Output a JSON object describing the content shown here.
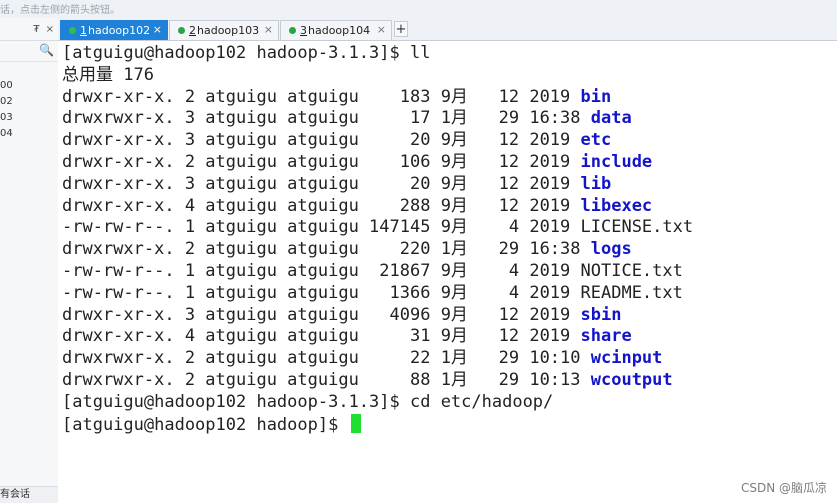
{
  "topbar": {
    "hint": "话，点击左侧的箭头按钮。"
  },
  "left_panel": {
    "pin_glyph": "₮",
    "close_glyph": "×",
    "search_glyph": "🔍",
    "items": [
      "00",
      "02",
      "03",
      "04"
    ],
    "footer_label": "有会话"
  },
  "tabs": [
    {
      "num": "1",
      "label": "hadoop102",
      "active": true
    },
    {
      "num": "2",
      "label": "hadoop103",
      "active": false
    },
    {
      "num": "3",
      "label": "hadoop104",
      "active": false
    }
  ],
  "tab_close_glyph": "×",
  "add_tab_glyph": "+",
  "terminal": {
    "lines": [
      {
        "text": "[atguigu@hadoop102 hadoop-3.1.3]$ ll",
        "name": ""
      },
      {
        "text": "总用量 176",
        "name": ""
      },
      {
        "text": "drwxr-xr-x. 2 atguigu atguigu    183 9月   12 2019 ",
        "name": "bin",
        "dir": true
      },
      {
        "text": "drwxrwxr-x. 3 atguigu atguigu     17 1月   29 16:38 ",
        "name": "data",
        "dir": true
      },
      {
        "text": "drwxr-xr-x. 3 atguigu atguigu     20 9月   12 2019 ",
        "name": "etc",
        "dir": true
      },
      {
        "text": "drwxr-xr-x. 2 atguigu atguigu    106 9月   12 2019 ",
        "name": "include",
        "dir": true
      },
      {
        "text": "drwxr-xr-x. 3 atguigu atguigu     20 9月   12 2019 ",
        "name": "lib",
        "dir": true
      },
      {
        "text": "drwxr-xr-x. 4 atguigu atguigu    288 9月   12 2019 ",
        "name": "libexec",
        "dir": true
      },
      {
        "text": "-rw-rw-r--. 1 atguigu atguigu 147145 9月    4 2019 ",
        "name": "LICENSE.txt",
        "dir": false
      },
      {
        "text": "drwxrwxr-x. 2 atguigu atguigu    220 1月   29 16:38 ",
        "name": "logs",
        "dir": true
      },
      {
        "text": "-rw-rw-r--. 1 atguigu atguigu  21867 9月    4 2019 ",
        "name": "NOTICE.txt",
        "dir": false
      },
      {
        "text": "-rw-rw-r--. 1 atguigu atguigu   1366 9月    4 2019 ",
        "name": "README.txt",
        "dir": false
      },
      {
        "text": "drwxr-xr-x. 3 atguigu atguigu   4096 9月   12 2019 ",
        "name": "sbin",
        "dir": true
      },
      {
        "text": "drwxr-xr-x. 4 atguigu atguigu     31 9月   12 2019 ",
        "name": "share",
        "dir": true
      },
      {
        "text": "drwxrwxr-x. 2 atguigu atguigu     22 1月   29 10:10 ",
        "name": "wcinput",
        "dir": true
      },
      {
        "text": "drwxrwxr-x. 2 atguigu atguigu     88 1月   29 10:13 ",
        "name": "wcoutput",
        "dir": true
      },
      {
        "text": "[atguigu@hadoop102 hadoop-3.1.3]$ cd etc/hadoop/",
        "name": ""
      }
    ],
    "prompt": "[atguigu@hadoop102 hadoop]$ "
  },
  "watermark": "CSDN @脑瓜凉",
  "colors": {
    "directory": "#1414c8",
    "cursor": "#1fe030",
    "active_tab": "#1f82d8"
  }
}
